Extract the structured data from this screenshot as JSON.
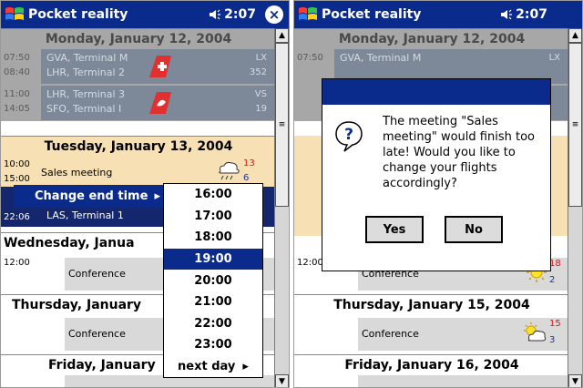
{
  "app": {
    "title": "Pocket reality",
    "time": "2:07",
    "ok_label": "×"
  },
  "days": {
    "mon": "Monday, January 12, 2004",
    "tue": "Tuesday, January 13, 2004",
    "wed_truncated": "Wednesday, Janua",
    "thu_truncated": "Thursday, January",
    "fri_truncated": "Friday, January",
    "thu": "Thursday, January 15, 2004",
    "fri": "Friday, January 16, 2004"
  },
  "flights": [
    {
      "dep_time": "07:50",
      "arr_time": "08:40",
      "from": "GVA, Terminal M",
      "to": "LHR, Terminal 2",
      "airline": "LX",
      "number": "352",
      "tail_color": "#e03030"
    },
    {
      "dep_time": "11:00",
      "arr_time": "14:05",
      "from": "LHR, Terminal 3",
      "to": "SFO, Terminal I",
      "airline": "VS",
      "number": "19",
      "tail_color": "#e03030"
    },
    {
      "dep_time": "",
      "arr_time": "22:06",
      "from": "",
      "to": "LAS, Terminal 1",
      "airline": "",
      "number": ""
    }
  ],
  "events": {
    "sales": {
      "time_start": "10:00",
      "time_end": "15:00",
      "label": "Sales meeting",
      "hi": "13",
      "lo": "6"
    },
    "conf_wed": {
      "time": "12:00",
      "label": "Conference",
      "hi": "18",
      "lo": "2"
    },
    "conf_thu": {
      "label": "Conference",
      "hi": "15",
      "lo": "3"
    }
  },
  "context_menu": {
    "item": "Change end time",
    "arrow": "▸"
  },
  "submenu": {
    "options": [
      "16:00",
      "17:00",
      "18:00",
      "19:00",
      "20:00",
      "21:00",
      "22:00",
      "23:00",
      "next day"
    ],
    "selected": "19:00",
    "next_arrow": "▸"
  },
  "dialog": {
    "message": "The meeting \"Sales meeting\" would finish too late! Would you like to change your flights accordingly?",
    "yes": "Yes",
    "no": "No"
  },
  "scroll": {
    "up": "▲",
    "down": "▼",
    "thumb": "≡"
  },
  "colors": {
    "title_bar": "#0a2a8c",
    "selection": "#0a2a8c",
    "today_bg": "#f7e0b3",
    "past_bg": "#a7a7a7",
    "temp_high": "#e01010",
    "temp_low": "#1030c8"
  }
}
